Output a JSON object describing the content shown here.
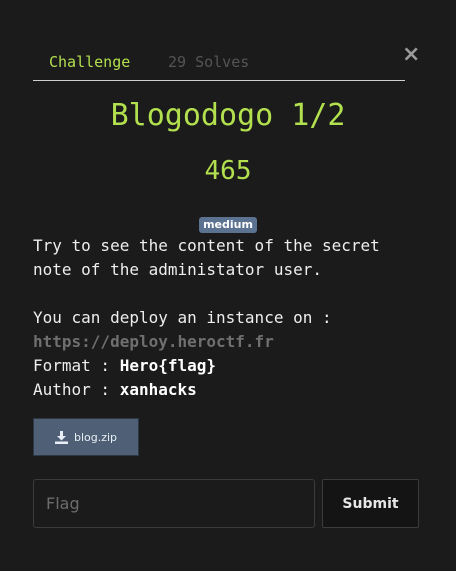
{
  "close_icon": "×",
  "tabs": [
    {
      "label": "Challenge"
    },
    {
      "label": "29 Solves"
    }
  ],
  "challenge": {
    "title": "Blogodogo 1/2",
    "points": "465",
    "difficulty": "medium",
    "description_line1": "Try to see the content of the secret",
    "description_line2": "note of the administator user.",
    "deploy_text": "You can deploy an instance on :",
    "deploy_url": "https://deploy.heroctf.fr",
    "format_label": "Format : ",
    "format_value": "Hero{flag}",
    "author_label": "Author : ",
    "author_value": "xanhacks"
  },
  "attachment": {
    "label": "blog.zip",
    "icon": "download-icon"
  },
  "form": {
    "placeholder": "Flag",
    "submit_label": "Submit"
  },
  "colors": {
    "accent": "#b2e04e",
    "badge": "#5b7390",
    "background": "#1b1b1b"
  }
}
